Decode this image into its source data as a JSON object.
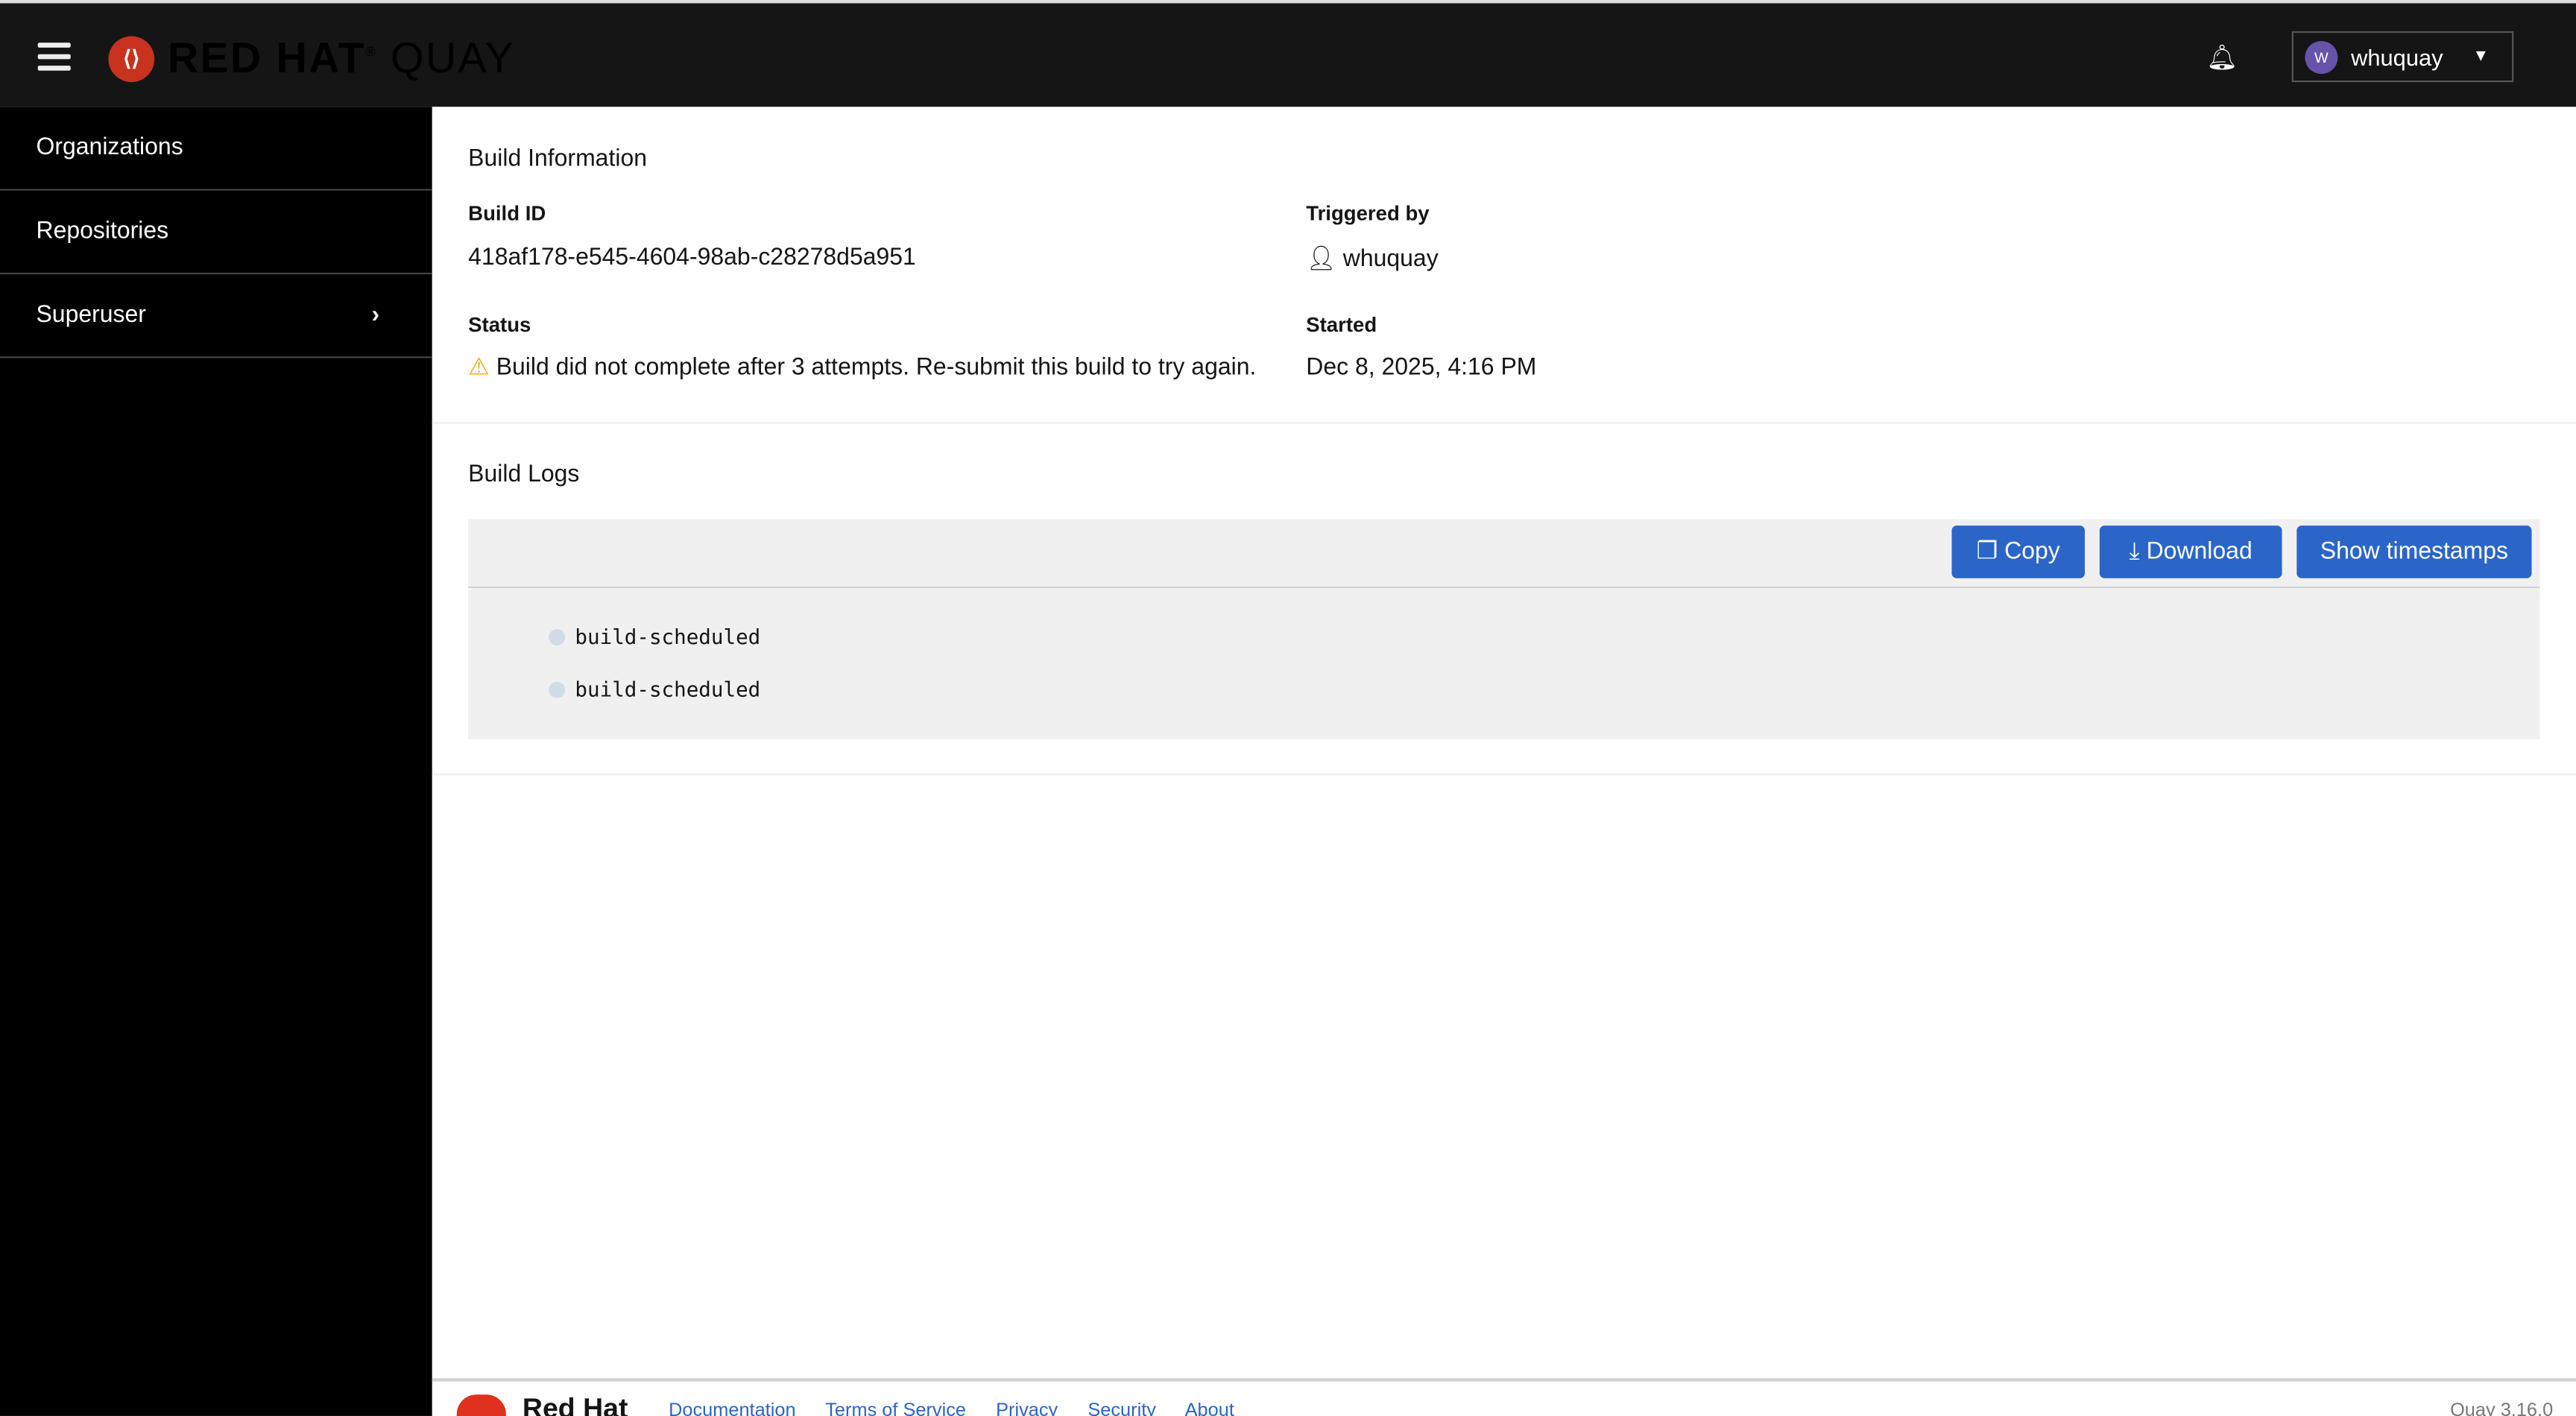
{
  "header": {
    "logo": "RED HAT QUAY",
    "logo_bold": "RED HAT",
    "logo_light": "QUAY",
    "user": "whuquay",
    "avatar_initial": "W"
  },
  "sidebar": {
    "items": [
      {
        "label": "Organizations"
      },
      {
        "label": "Repositories"
      },
      {
        "label": "Superuser"
      }
    ]
  },
  "build_info": {
    "title": "Build Information",
    "build_id_label": "Build ID",
    "build_id": "418af178-e545-4604-98ab-c28278d5a951",
    "triggered_label": "Triggered by",
    "triggered_by": "whuquay",
    "status_label": "Status",
    "status": "Build did not complete after 3 attempts. Re-submit this build to try again.",
    "started_label": "Started",
    "started": "Dec 8, 2025, 4:16 PM"
  },
  "build_logs": {
    "title": "Build Logs",
    "copy": "Copy",
    "download": "Download",
    "show_timestamps": "Show timestamps",
    "lines": [
      "build-scheduled",
      "build-scheduled"
    ]
  },
  "footer": {
    "brand": "Red Hat",
    "links": [
      "Documentation",
      "Terms of Service",
      "Privacy",
      "Security",
      "About"
    ],
    "version": "Quay 3.16.0"
  },
  "colors": {
    "primary": "#2b65c8",
    "warning": "#f0ab00",
    "header": "#151515",
    "sidebar": "#000000"
  }
}
